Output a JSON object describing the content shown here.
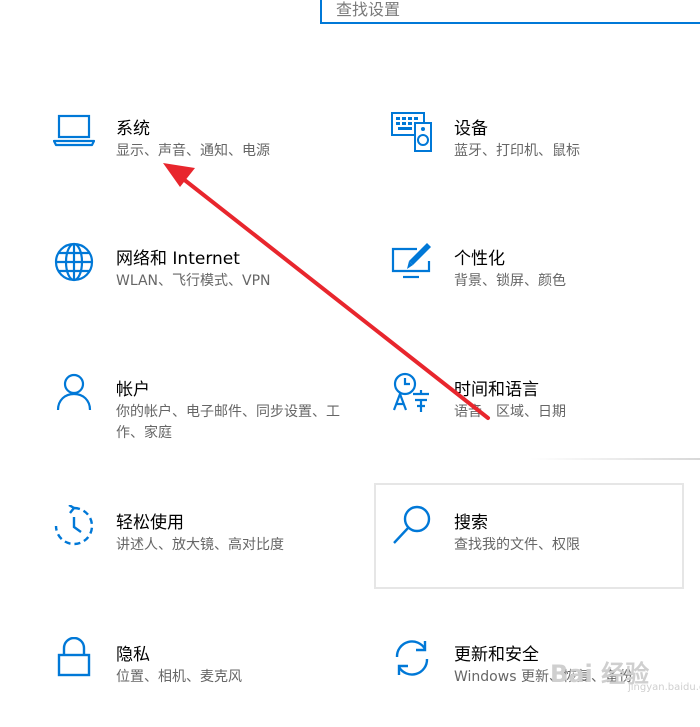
{
  "search": {
    "placeholder": "查找设置"
  },
  "tiles": [
    {
      "title": "系统",
      "desc": "显示、声音、通知、电源",
      "icon": "laptop-icon"
    },
    {
      "title": "设备",
      "desc": "蓝牙、打印机、鼠标",
      "icon": "keyboard-speaker-icon"
    },
    {
      "title": "网络和 Internet",
      "desc": "WLAN、飞行模式、VPN",
      "icon": "globe-icon"
    },
    {
      "title": "个性化",
      "desc": "背景、锁屏、颜色",
      "icon": "paint-monitor-icon"
    },
    {
      "title": "帐户",
      "desc": "你的帐户、电子邮件、同步设置、工作、家庭",
      "icon": "person-icon"
    },
    {
      "title": "时间和语言",
      "desc": "语音、区域、日期",
      "icon": "clock-language-icon"
    },
    {
      "title": "轻松使用",
      "desc": "讲述人、放大镜、高对比度",
      "icon": "ease-of-access-icon"
    },
    {
      "title": "搜索",
      "desc": "查找我的文件、权限",
      "icon": "search-icon"
    },
    {
      "title": "隐私",
      "desc": "位置、相机、麦克风",
      "icon": "lock-icon"
    },
    {
      "title": "更新和安全",
      "desc": "Windows 更新、恢复、备份",
      "icon": "sync-icon"
    }
  ],
  "watermark": {
    "text": "Bai 经验",
    "sub": "jingyan.baidu.com"
  },
  "colors": {
    "accent": "#0078d7",
    "arrow": "#e8262d",
    "desc": "#666666"
  }
}
